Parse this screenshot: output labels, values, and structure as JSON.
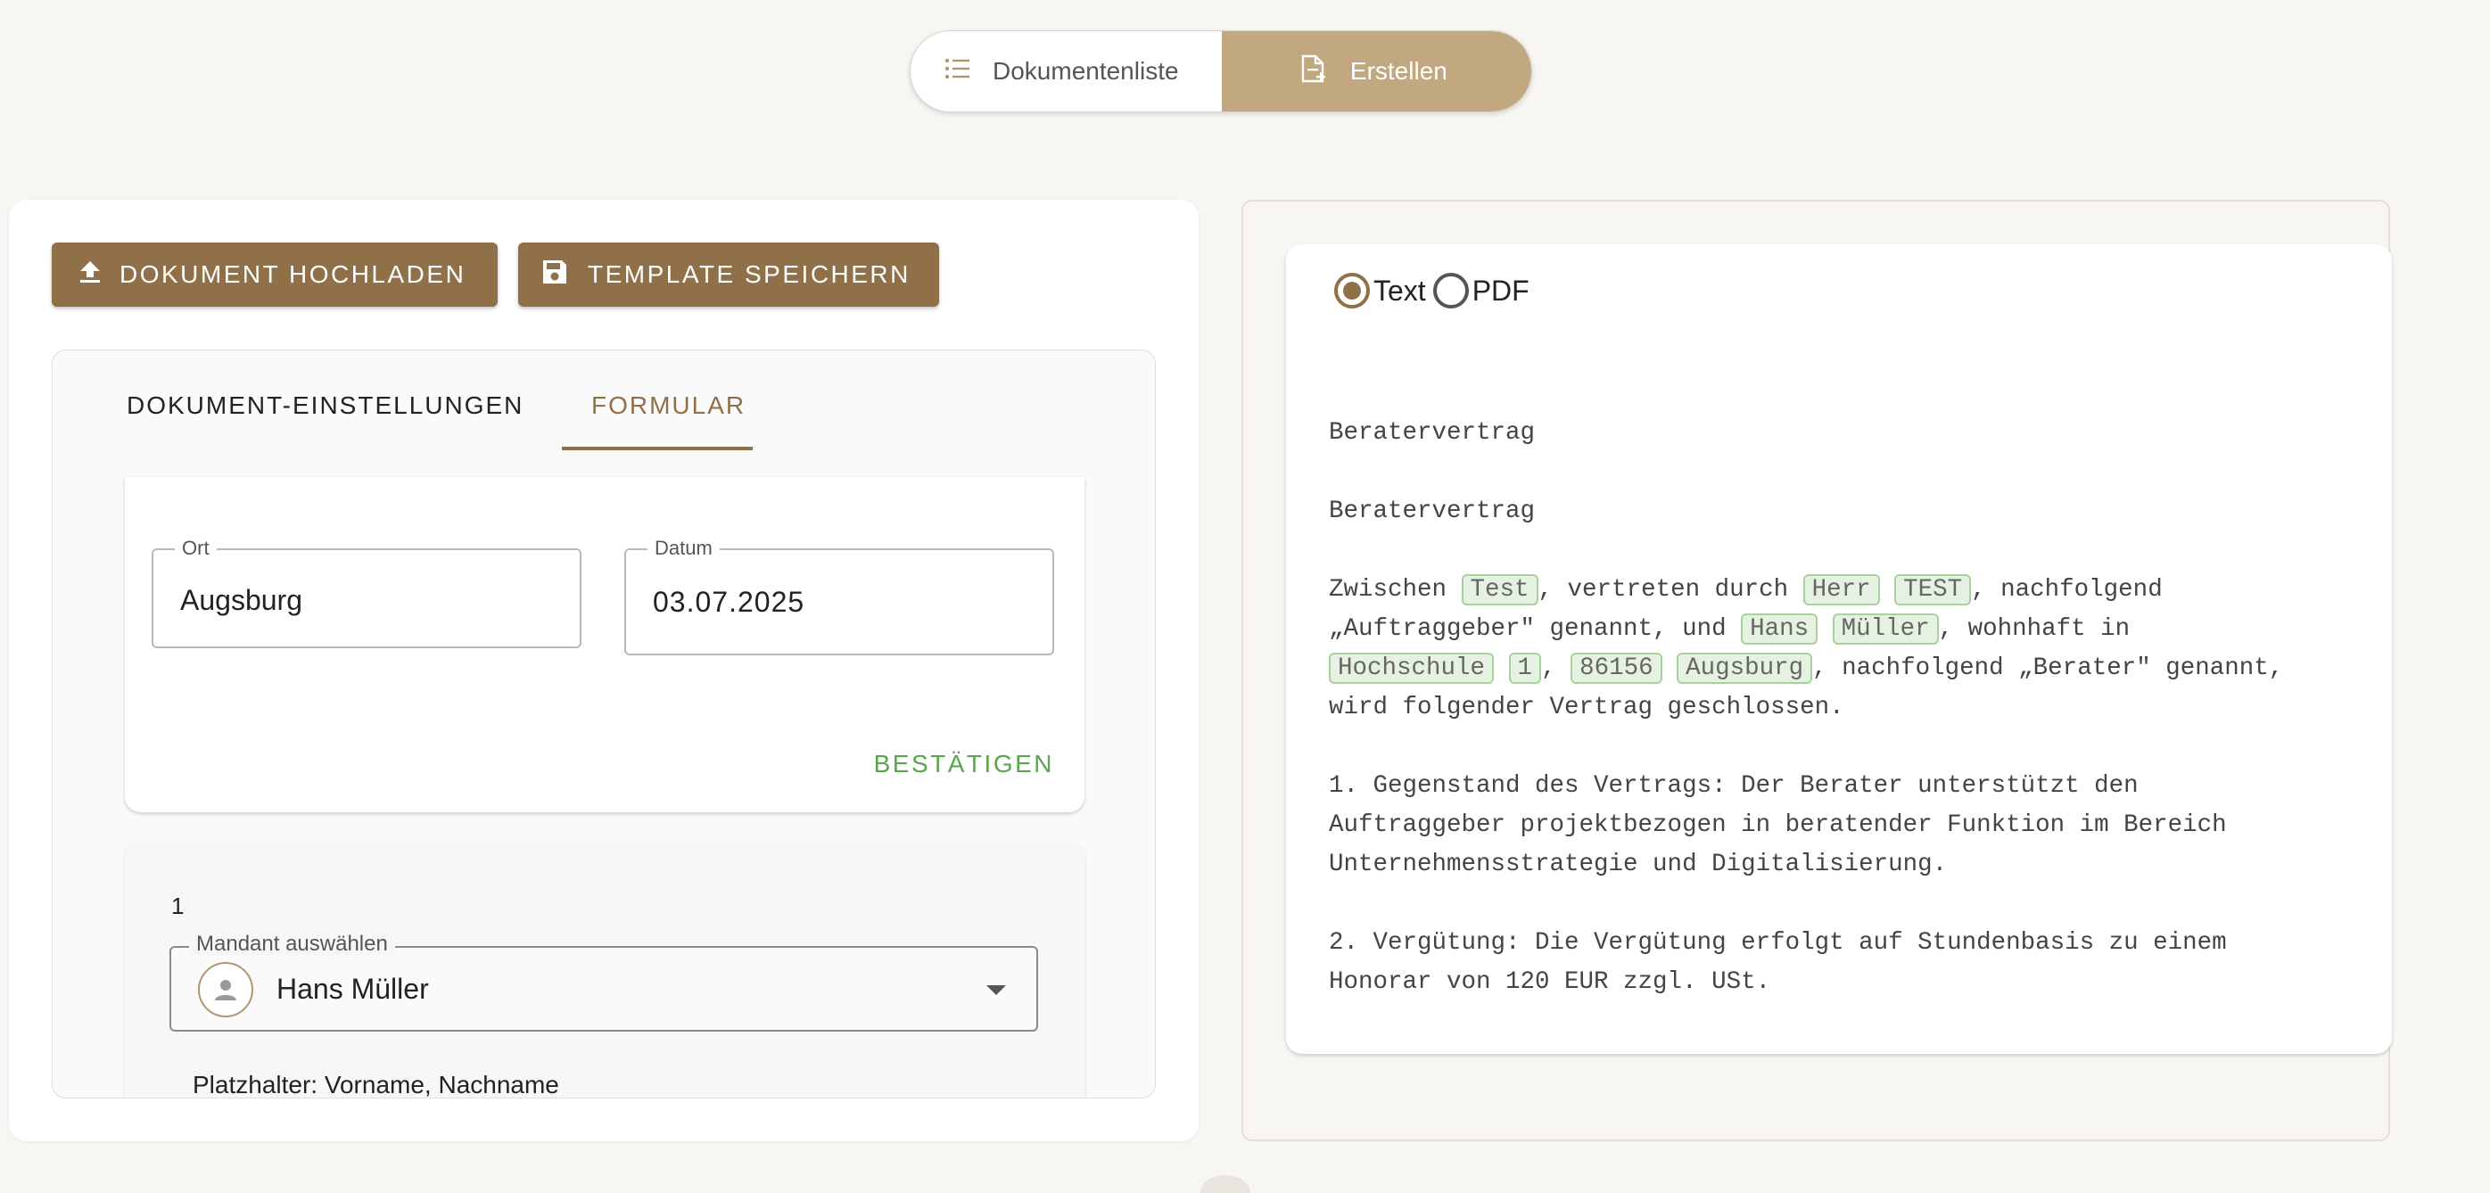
{
  "nav": {
    "list_label": "Dokumentenliste",
    "create_label": "Erstellen"
  },
  "toolbar": {
    "upload_label": "DOKUMENT HOCHLADEN",
    "save_template_label": "TEMPLATE SPEICHERN"
  },
  "tabs": {
    "settings_label": "DOKUMENT-EINSTELLUNGEN",
    "form_label": "FORMULAR"
  },
  "form": {
    "ort_label": "Ort",
    "ort_value": "Augsburg",
    "datum_label": "Datum",
    "datum_value": "03.07.2025",
    "confirm_label": "BESTÄTIGEN"
  },
  "mandant": {
    "index": "1",
    "select_label": "Mandant auswählen",
    "select_value": "Hans Müller",
    "placeholder_label": "Platzhalter: Vorname, Nachname"
  },
  "preview": {
    "radio_text_label": "Text",
    "radio_pdf_label": "PDF",
    "heading_1": "Beratervertrag",
    "heading_2": "Beratervertrag",
    "p1_part1": "Zwischen ",
    "chip_company": "Test",
    "p1_part2": ", vertreten durch ",
    "chip_salutation": "Herr",
    "chip_rep_name": "TEST",
    "p1_part3": ", nachfolgend\n„Auftraggeber\" genannt, und ",
    "chip_firstname": "Hans",
    "chip_lastname": "Müller",
    "p1_part4": ", wohnhaft in\n",
    "chip_street": "Hochschule",
    "chip_housenumber": "1",
    "p1_sep": ", ",
    "chip_zip": "86156",
    "chip_city": "Augsburg",
    "p1_part5": ", nachfolgend „Berater\" genannt,\nwird folgender Vertrag geschlossen.",
    "section_1": "1. Gegenstand des Vertrags: Der Berater unterstützt den\nAuftraggeber projektbezogen in beratender Funktion im Bereich\nUnternehmensstrategie und Digitalisierung.",
    "section_2": "2. Vergütung: Die Vergütung erfolgt auf Stundenbasis zu einem\nHonorar von 120 EUR zzgl. USt."
  },
  "colors": {
    "accent": "#8f7048",
    "accent_light": "#c2a880",
    "confirm_green": "#5aa64c",
    "chip_bg": "#e5f2e1",
    "chip_border": "#a9d19f"
  },
  "icons": {
    "list": "list-icon",
    "create": "file-plus-icon",
    "upload": "upload-icon",
    "save": "save-icon",
    "avatar": "person-icon",
    "dropdown": "caret-down-icon"
  }
}
